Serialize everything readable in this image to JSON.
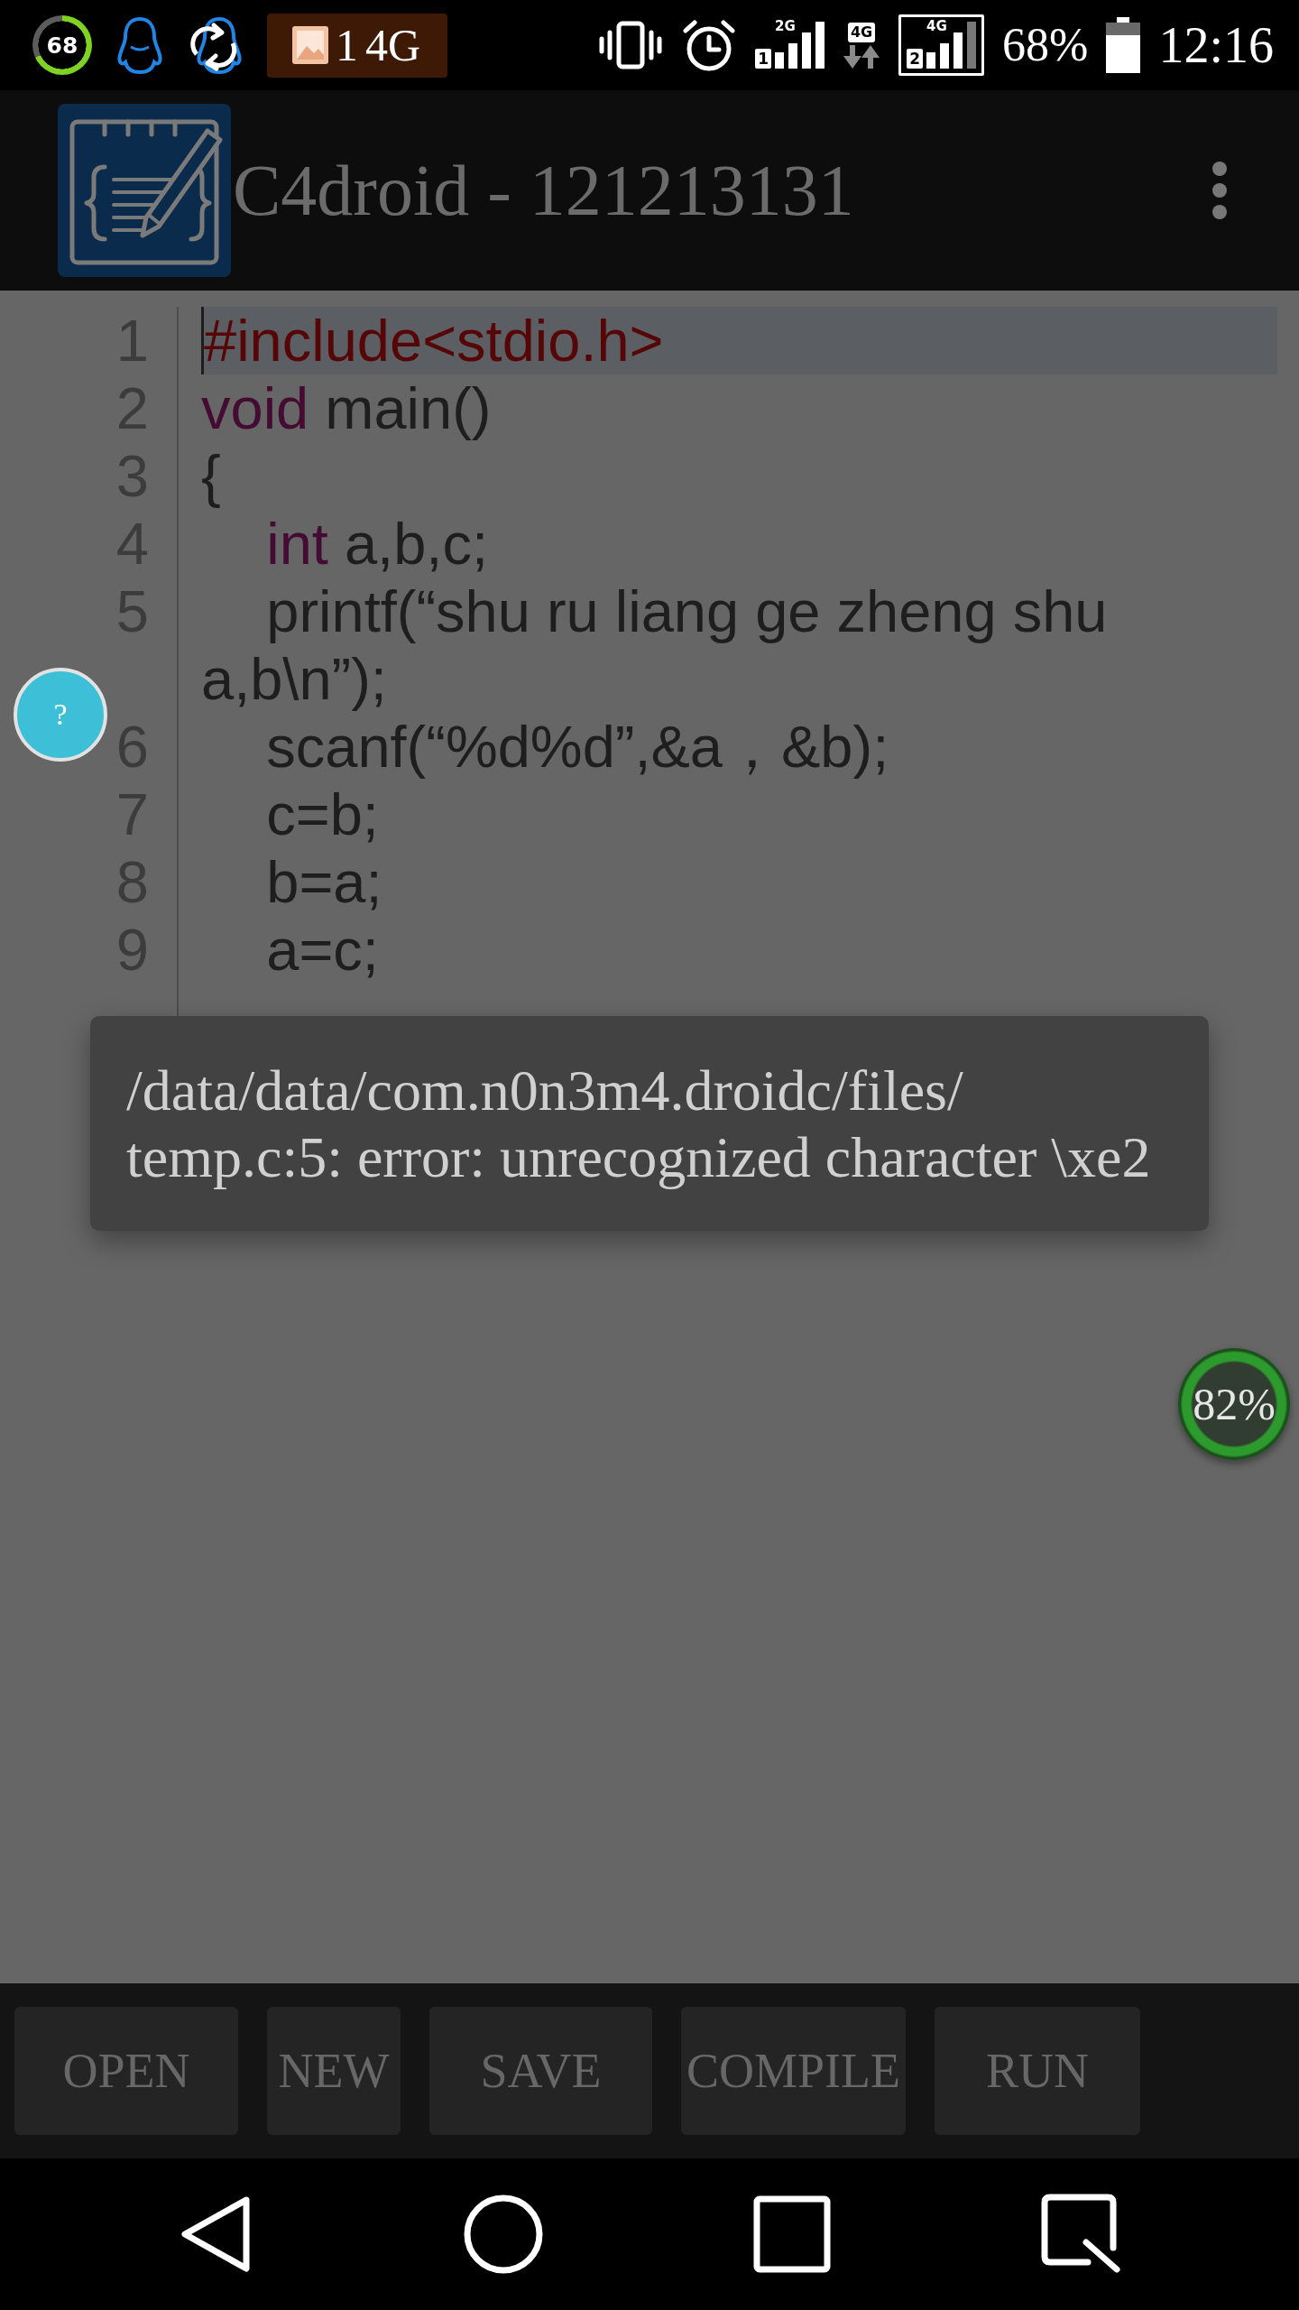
{
  "status_bar": {
    "gauge": {
      "value": "68"
    },
    "notification": {
      "count": "1",
      "label": "4G"
    },
    "indicators": [
      {
        "kind": "signal",
        "network": "2G",
        "sim": "1",
        "selected": false
      },
      {
        "kind": "data",
        "label": "4G"
      },
      {
        "kind": "signal",
        "network": "4G",
        "sim": "2",
        "selected": true
      }
    ],
    "battery": "68%",
    "time": "12:16"
  },
  "app_bar": {
    "title": "C4droid - 121213131"
  },
  "editor": {
    "lines": [
      {
        "number": "1",
        "selected": true,
        "tokens": [
          {
            "kind": "preprocessor",
            "text": "#include<stdio.h>"
          }
        ]
      },
      {
        "number": "2",
        "selected": false,
        "tokens": [
          {
            "kind": "keyword",
            "text": "void"
          },
          {
            "kind": "plain",
            "text": " main()"
          }
        ]
      },
      {
        "number": "3",
        "selected": false,
        "tokens": [
          {
            "kind": "plain",
            "text": "{"
          }
        ]
      },
      {
        "number": "4",
        "selected": false,
        "tokens": [
          {
            "kind": "keyword",
            "text": "    int"
          },
          {
            "kind": "plain",
            "text": " a,b,c;"
          }
        ]
      },
      {
        "number": "5",
        "selected": false,
        "tokens": [
          {
            "kind": "plain",
            "text": "    printf(“shu ru liang ge zheng shu a,b\\n”);"
          }
        ]
      },
      {
        "number": "6",
        "selected": false,
        "tokens": [
          {
            "kind": "plain",
            "text": "    scanf(“%d%d”,&a，&b);"
          }
        ]
      },
      {
        "number": "7",
        "selected": false,
        "tokens": [
          {
            "kind": "plain",
            "text": "    c=b;"
          }
        ]
      },
      {
        "number": "8",
        "selected": false,
        "tokens": [
          {
            "kind": "plain",
            "text": "    b=a;"
          }
        ]
      },
      {
        "number": "9",
        "selected": false,
        "tokens": [
          {
            "kind": "plain",
            "text": "    a=c;"
          }
        ]
      }
    ]
  },
  "help_bubble": {
    "label": "?"
  },
  "toast": {
    "lines": [
      "/data/data/com.n0n3m4.droidc/files/",
      "temp.c:5: error: unrecognized character \\xe2"
    ]
  },
  "percent_bubble": {
    "label": "82%"
  },
  "toolbar": {
    "buttons": [
      "OPEN",
      "NEW",
      "SAVE",
      "COMPILE",
      "RUN"
    ]
  }
}
